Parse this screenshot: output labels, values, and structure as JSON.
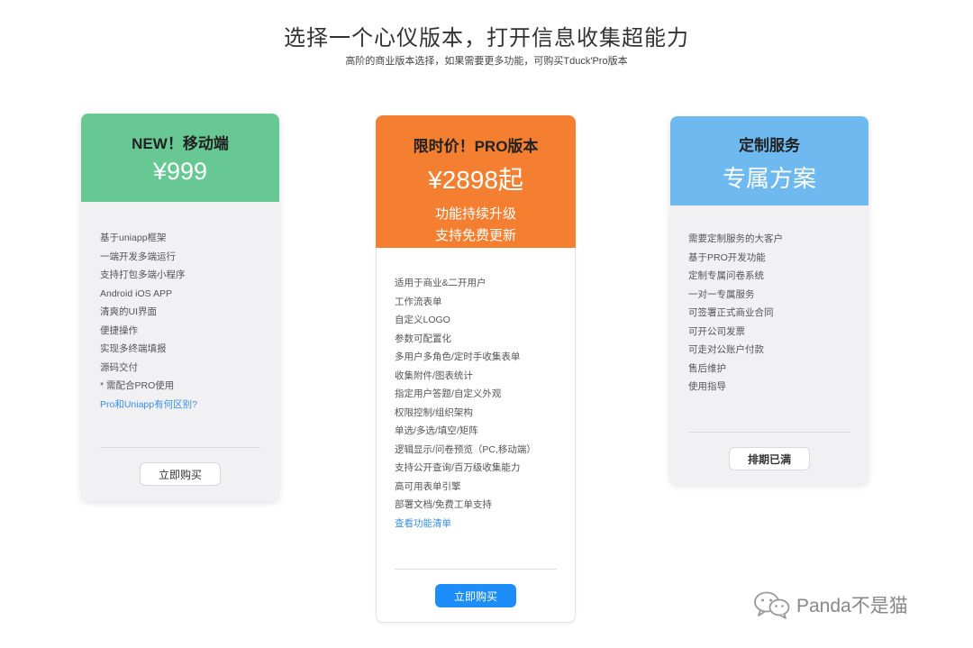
{
  "hero": {
    "title": "选择一个心仪版本，打开信息收集超能力",
    "subtitle": "高阶的商业版本选择，如果需要更多功能，可购买Tduck'Pro版本"
  },
  "cards": [
    {
      "title": "NEW！移动端",
      "price": "¥999",
      "header_color": "#67c894",
      "features": [
        "基于uniapp框架",
        "一端开发多端运行",
        "支持打包多端小程序",
        "Android iOS APP",
        "清爽的UI界面",
        "便捷操作",
        "实现多终端填报",
        "源码交付",
        "* 需配合PRO使用"
      ],
      "link": "Pro和Uniapp有何区别?",
      "button": "立即购买"
    },
    {
      "title": "限时价！PRO版本",
      "price": "¥2898起",
      "tagline1": "功能持续升级",
      "tagline2": "支持免费更新",
      "header_color": "#f57f30",
      "features": [
        "适用于商业&二开用户",
        "工作流表单",
        "自定义LOGO",
        "参数可配置化",
        "多用户多角色/定时手收集表单",
        "收集附件/图表统计",
        "指定用户答题/自定义外观",
        "权限控制/组织架构",
        "单选/多选/填空/矩阵",
        "逻辑显示/问卷预览（PC,移动端）",
        "支持公开查询/百万级收集能力",
        "高可用表单引擎",
        "部署文档/免费工单支持"
      ],
      "link": "查看功能清单",
      "button": "立即购买"
    },
    {
      "title": "定制服务",
      "price": "专属方案",
      "header_color": "#6eb9f0",
      "features": [
        "需要定制服务的大客户",
        "基于PRO开发功能",
        "定制专属问卷系统",
        "一对一专属服务",
        "可签署正式商业合同",
        "可开公司发票",
        "可走对公账户付款",
        "售后维护",
        "使用指导"
      ],
      "button": "排期已满"
    }
  ],
  "watermark": {
    "icon": "wechat-icon",
    "text": "Panda不是猫"
  }
}
